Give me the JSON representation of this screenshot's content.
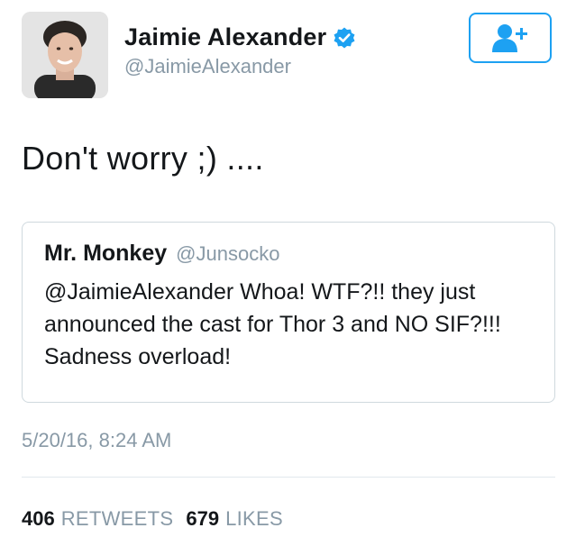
{
  "colors": {
    "accent": "#1da1f2",
    "secondary_text": "#8899a6",
    "border": "#cfd9de"
  },
  "author": {
    "display_name": "Jaimie Alexander",
    "handle": "@JaimieAlexander",
    "verified_icon": "verified-badge-icon",
    "follow_icon": "add-user-icon"
  },
  "tweet": {
    "text": "Don't worry ;) ....",
    "timestamp": "5/20/16, 8:24 AM"
  },
  "quoted_tweet": {
    "display_name": "Mr. Monkey",
    "handle": "@Junsocko",
    "text": "@JaimieAlexander Whoa! WTF?!! they just announced the cast for Thor 3 and NO SIF?!!! Sadness overload!"
  },
  "stats": {
    "retweets_count": "406",
    "retweets_label": "RETWEETS",
    "likes_count": "679",
    "likes_label": "LIKES"
  }
}
